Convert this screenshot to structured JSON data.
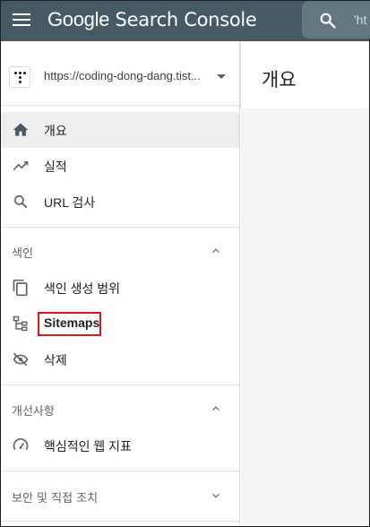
{
  "app": {
    "brand_google": "Google",
    "brand_product": "Search Console",
    "search_text": "'ht",
    "colors": {
      "appbar": "#455a64",
      "highlight": "#e0121c",
      "active_bg": "#eeeeee"
    }
  },
  "property": {
    "url": "https://coding-dong-dang.tist...",
    "avatar_icon": "dots-logo",
    "caret_icon": "caret-down-icon"
  },
  "nav": {
    "overview": {
      "label": "개요",
      "icon": "home-icon"
    },
    "performance": {
      "label": "실적",
      "icon": "trending-up-icon"
    },
    "url_inspection": {
      "label": "URL 검사",
      "icon": "search-icon"
    }
  },
  "index_section": {
    "title": "색인",
    "items": [
      {
        "label": "색인 생성 범위",
        "icon": "copy-icon"
      },
      {
        "label": "Sitemaps",
        "icon": "sitemap-icon"
      },
      {
        "label": "삭제",
        "icon": "visibility-off-icon"
      }
    ]
  },
  "enhancements_section": {
    "title": "개선사항",
    "items": [
      {
        "label": "핵심적인 웹 지표",
        "icon": "speed-gauge-icon"
      }
    ]
  },
  "security_section": {
    "title": "보안 및 직접 조치"
  },
  "main": {
    "title": "개요"
  }
}
